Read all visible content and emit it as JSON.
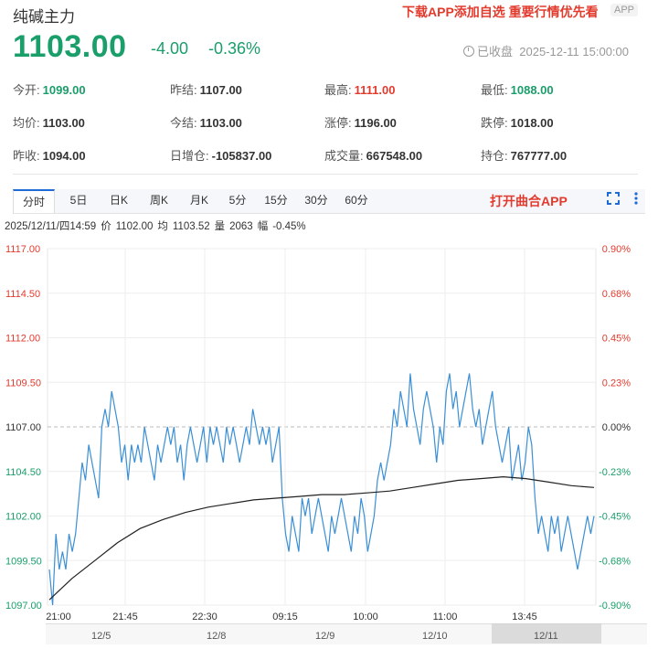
{
  "header": {
    "title": "纯碱主力",
    "promo": "下载APP添加自选 重要行情优先看",
    "app_badge": "APP"
  },
  "quote": {
    "price": "1103.00",
    "change": "-4.00",
    "change_pct": "-0.36%",
    "status": "已收盘",
    "datetime": "2025-12-11 15:00:00"
  },
  "stats": [
    [
      {
        "label": "今开:",
        "value": "1099.00",
        "tone": "down"
      },
      {
        "label": "昨结:",
        "value": "1107.00",
        "tone": ""
      },
      {
        "label": "最高:",
        "value": "1111.00",
        "tone": "up"
      },
      {
        "label": "最低:",
        "value": "1088.00",
        "tone": "down"
      }
    ],
    [
      {
        "label": "均价:",
        "value": "1103.00",
        "tone": ""
      },
      {
        "label": "今结:",
        "value": "1103.00",
        "tone": ""
      },
      {
        "label": "涨停:",
        "value": "1196.00",
        "tone": ""
      },
      {
        "label": "跌停:",
        "value": "1018.00",
        "tone": ""
      }
    ],
    [
      {
        "label": "昨收:",
        "value": "1094.00",
        "tone": ""
      },
      {
        "label": "日增仓:",
        "value": "-105837.00",
        "tone": ""
      },
      {
        "label": "成交量:",
        "value": "667548.00",
        "tone": ""
      },
      {
        "label": "持仓:",
        "value": "767777.00",
        "tone": ""
      }
    ]
  ],
  "tabs": [
    "分时",
    "5日",
    "日K",
    "周K",
    "月K",
    "5分",
    "15分",
    "30分",
    "60分"
  ],
  "active_tab": "分时",
  "open_app": "打开曲合APP",
  "info": {
    "datetime": "2025/12/11/四14:59",
    "price_label": "价",
    "price": "1102.00",
    "avg_label": "均",
    "avg": "1103.52",
    "vol_label": "量",
    "vol": "2063",
    "amp_label": "幅",
    "amp": "-0.45%"
  },
  "colors": {
    "up": "#e23b2e",
    "down": "#1a9e6a",
    "price_line": "#3a8fd6",
    "avg_line": "#222222"
  },
  "chart_data": {
    "type": "line",
    "y_ticks": [
      "1117.00",
      "1114.50",
      "1112.00",
      "1109.50",
      "1107.00",
      "1104.50",
      "1102.00",
      "1099.50",
      "1097.00"
    ],
    "y_tick_values": [
      1117,
      1114.5,
      1112,
      1109.5,
      1107,
      1104.5,
      1102,
      1099.5,
      1097
    ],
    "pct_ticks": [
      "0.90%",
      "0.68%",
      "0.45%",
      "0.23%",
      "0.00%",
      "-0.23%",
      "-0.45%",
      "-0.68%",
      "-0.90%"
    ],
    "x_ticks": [
      "21:00",
      "21:45",
      "22:30",
      "09:15",
      "10:00",
      "11:00",
      "13:45"
    ],
    "ylim": [
      1097,
      1117
    ],
    "prev_settle": 1107,
    "nav_dates": [
      "12/5",
      "12/8",
      "12/9",
      "12/10",
      "12/11"
    ],
    "series": [
      {
        "name": "价",
        "values": [
          1099,
          1097,
          1101,
          1099,
          1100,
          1099,
          1101,
          1100,
          1101,
          1103,
          1105,
          1104,
          1106,
          1105,
          1104,
          1103,
          1107,
          1108,
          1107,
          1109,
          1108,
          1107,
          1105,
          1106,
          1104,
          1106,
          1105,
          1106,
          1105,
          1107,
          1106,
          1105,
          1104,
          1106,
          1105,
          1106,
          1107,
          1106,
          1107,
          1105,
          1106,
          1104,
          1106,
          1107,
          1106,
          1105,
          1106,
          1107,
          1105,
          1107,
          1106,
          1107,
          1106,
          1105,
          1107,
          1106,
          1107,
          1106,
          1105,
          1106,
          1107,
          1106,
          1108,
          1107,
          1106,
          1107,
          1106,
          1107,
          1105,
          1106,
          1107,
          1103,
          1101,
          1100,
          1102,
          1101,
          1100,
          1103,
          1102,
          1103,
          1101,
          1102,
          1103,
          1102,
          1101,
          1100,
          1102,
          1101,
          1102,
          1103,
          1102,
          1101,
          1100,
          1102,
          1101,
          1103,
          1102,
          1100,
          1101,
          1102,
          1104,
          1105,
          1104,
          1105,
          1106,
          1108,
          1107,
          1109,
          1108,
          1107,
          1110,
          1108,
          1107,
          1106,
          1108,
          1109,
          1108,
          1107,
          1105,
          1107,
          1106,
          1109,
          1110,
          1108,
          1109,
          1107,
          1108,
          1109,
          1110,
          1108,
          1107,
          1108,
          1106,
          1107,
          1108,
          1109,
          1107,
          1106,
          1105,
          1106,
          1107,
          1104,
          1105,
          1106,
          1104,
          1105,
          1107,
          1106,
          1103,
          1101,
          1102,
          1101,
          1100,
          1102,
          1101,
          1102,
          1100,
          1101,
          1102,
          1101,
          1100,
          1099,
          1100,
          1101,
          1102,
          1101,
          1102
        ]
      },
      {
        "name": "均",
        "values": [
          1097.3,
          1098.5,
          1099.5,
          1100.5,
          1101.3,
          1101.8,
          1102.2,
          1102.5,
          1102.7,
          1102.9,
          1103,
          1103.1,
          1103.2,
          1103.2,
          1103.3,
          1103.4,
          1103.6,
          1103.8,
          1104,
          1104.1,
          1104.2,
          1104.1,
          1103.9,
          1103.7,
          1103.6
        ]
      }
    ]
  }
}
